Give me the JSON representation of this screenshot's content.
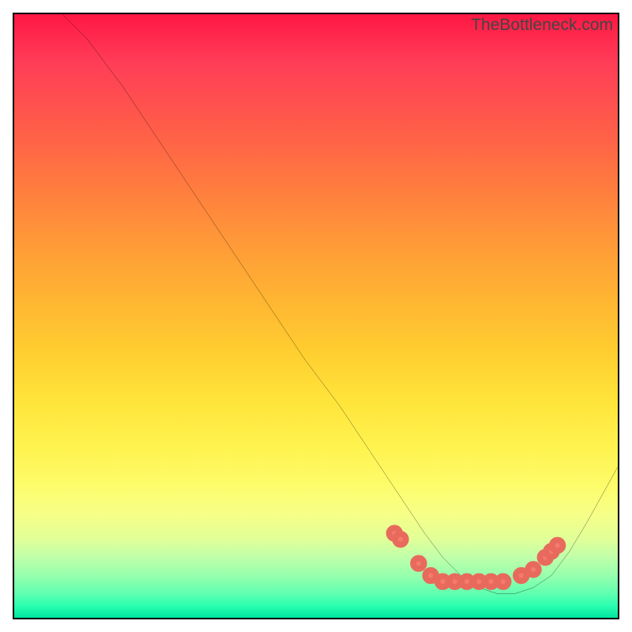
{
  "watermark": "TheBottleneck.com",
  "chart_data": {
    "type": "line",
    "title": "",
    "xlabel": "",
    "ylabel": "",
    "xlim": [
      0,
      100
    ],
    "ylim": [
      0,
      100
    ],
    "series": [
      {
        "name": "curve",
        "x": [
          8,
          12,
          18,
          24,
          30,
          36,
          42,
          48,
          54,
          60,
          64,
          68,
          71,
          74,
          77,
          80,
          83,
          86,
          89,
          92,
          95,
          100
        ],
        "y": [
          100,
          96,
          88,
          79,
          70,
          61,
          52,
          43,
          35,
          26,
          20,
          14,
          10,
          7,
          5,
          4,
          4,
          5,
          7,
          11,
          16,
          25
        ]
      }
    ],
    "markers": {
      "name": "highlight-dots",
      "x": [
        63,
        64,
        67,
        69,
        71,
        73,
        75,
        77,
        79,
        81,
        84,
        86,
        88,
        89,
        90
      ],
      "y": [
        14,
        13,
        9,
        7,
        6,
        6,
        6,
        6,
        6,
        6,
        7,
        8,
        10,
        11,
        12
      ]
    },
    "background": "heat-gradient-red-to-green"
  }
}
